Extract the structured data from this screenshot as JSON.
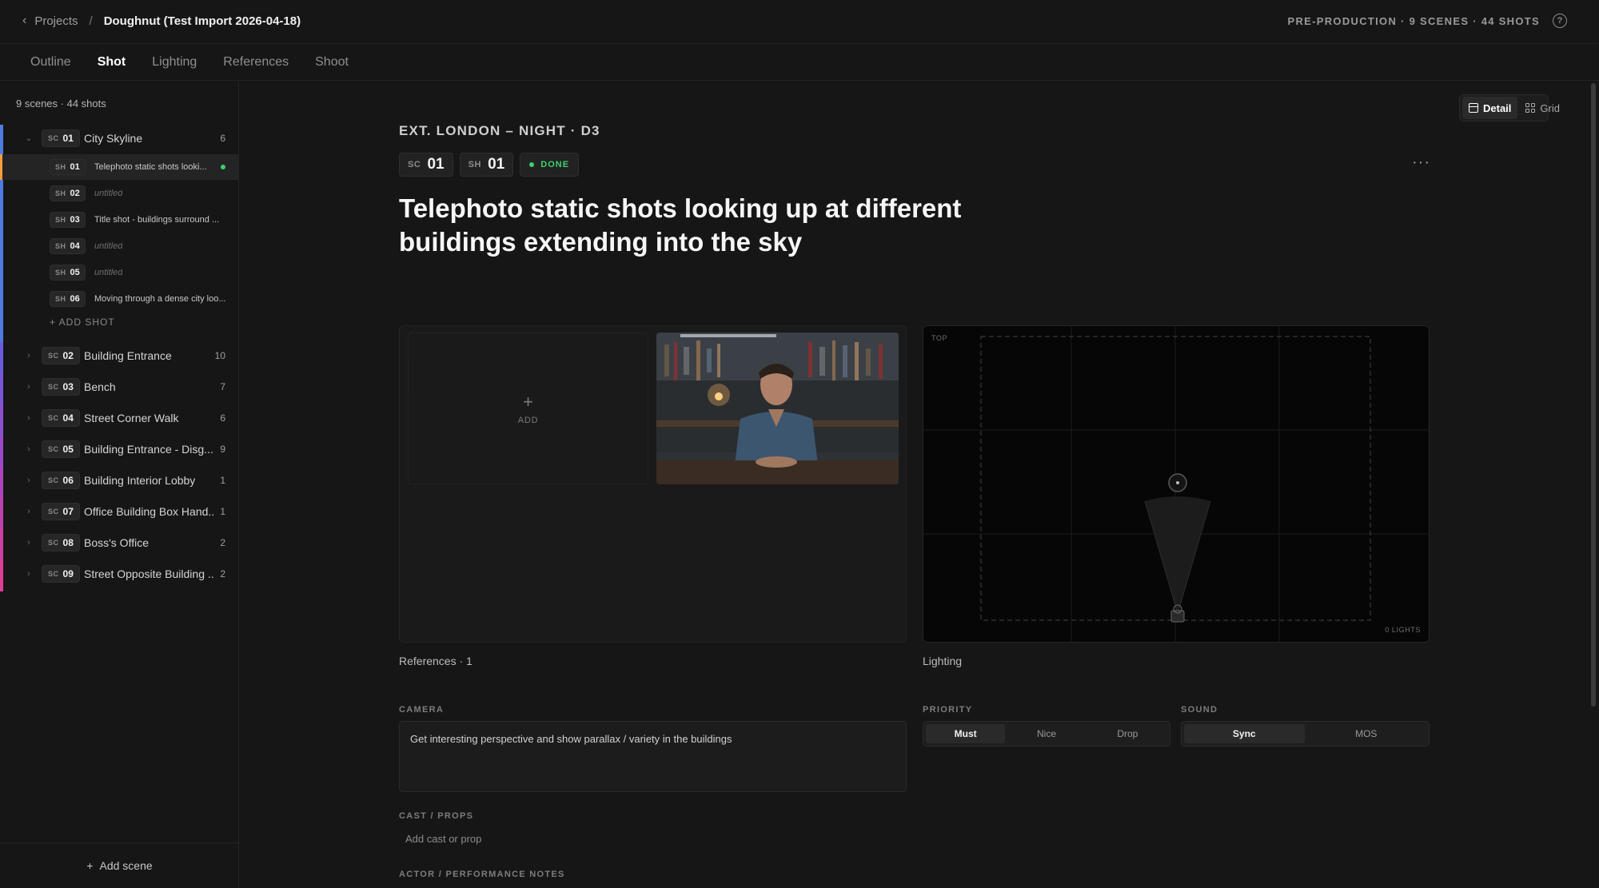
{
  "breadcrumb": {
    "back_label": "Projects",
    "separator": "/",
    "project": "Doughnut (Test Import 2026-04-18)"
  },
  "header": {
    "phase": "PRE-PRODUCTION · 9 SCENES · 44 SHOTS"
  },
  "tabs": [
    {
      "label": "Outline",
      "active": false
    },
    {
      "label": "Shot",
      "active": true
    },
    {
      "label": "Lighting",
      "active": false
    },
    {
      "label": "References",
      "active": false
    },
    {
      "label": "Shoot",
      "active": false
    }
  ],
  "sidebar": {
    "summary": "9 scenes · 44 shots",
    "scene_prefix": "SC",
    "shot_prefix": "SH",
    "add_shot_label": "+ ADD SHOT",
    "add_scene_label": "Add scene",
    "expanded_scene": {
      "num": "01",
      "name": "City Skyline",
      "count": "6",
      "color": "#4f7be0",
      "shots": [
        {
          "num": "01",
          "title": "Telephoto static shots looki...",
          "untitled": false,
          "active": true,
          "done": true
        },
        {
          "num": "02",
          "title": "untitled",
          "untitled": true
        },
        {
          "num": "03",
          "title": "Title shot - buildings surround ...",
          "untitled": false
        },
        {
          "num": "04",
          "title": "untitled",
          "untitled": true
        },
        {
          "num": "05",
          "title": "untitled",
          "untitled": true
        },
        {
          "num": "06",
          "title": "Moving through a dense city loo...",
          "untitled": false
        }
      ]
    },
    "scenes": [
      {
        "num": "02",
        "name": "Building Entrance",
        "count": "10",
        "color": "#6b5be0"
      },
      {
        "num": "03",
        "name": "Bench",
        "count": "7",
        "color": "#7a55d8"
      },
      {
        "num": "04",
        "name": "Street Corner Walk",
        "count": "6",
        "color": "#8c4ed0"
      },
      {
        "num": "05",
        "name": "Building Entrance - Disg...",
        "count": "9",
        "color": "#9c48c8"
      },
      {
        "num": "06",
        "name": "Building Interior Lobby",
        "count": "1",
        "color": "#ad44bd"
      },
      {
        "num": "07",
        "name": "Office Building Box Hand...",
        "count": "1",
        "color": "#be41b0"
      },
      {
        "num": "08",
        "name": "Boss's Office",
        "count": "2",
        "color": "#cf3fa3"
      },
      {
        "num": "09",
        "name": "Street Opposite Building ...",
        "count": "2",
        "color": "#df3e94"
      }
    ]
  },
  "view_toggle": {
    "detail": "Detail",
    "grid": "Grid"
  },
  "shot": {
    "location": "EXT. LONDON – NIGHT · D3",
    "sc_prefix": "SC",
    "sc_num": "01",
    "sh_prefix": "SH",
    "sh_num": "01",
    "status": "DONE",
    "title": "Telephoto static shots looking up at different buildings extending into the sky",
    "more": "···"
  },
  "references": {
    "add_label": "ADD",
    "label": "References · 1"
  },
  "lighting": {
    "label": "Lighting",
    "view_label": "TOP",
    "count_label": "0 LIGHTS"
  },
  "fields": {
    "camera_label": "CAMERA",
    "camera_value": "Get interesting perspective and show parallax / variety in the buildings",
    "priority_label": "PRIORITY",
    "priority_options": [
      "Must",
      "Nice",
      "Drop"
    ],
    "priority_selected": "Must",
    "sound_label": "SOUND",
    "sound_options": [
      "Sync",
      "MOS"
    ],
    "sound_selected": "Sync",
    "cast_label": "CAST / PROPS",
    "cast_placeholder": "Add cast or prop",
    "perf_label": "ACTOR / PERFORMANCE NOTES"
  },
  "colors": {
    "accent_active": "#f59e3c",
    "status_done": "#3ecf6e"
  }
}
